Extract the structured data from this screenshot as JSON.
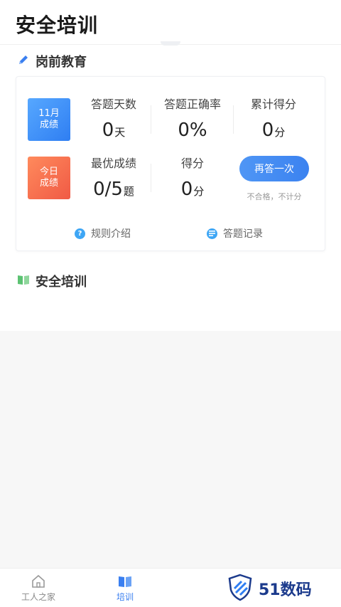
{
  "header": {
    "title": "安全培训"
  },
  "section_education": {
    "title": "岗前教育"
  },
  "badges": {
    "month": {
      "line1": "11月",
      "line2": "成绩"
    },
    "today": {
      "line1": "今日",
      "line2": "成绩"
    }
  },
  "stats": {
    "answer_days": {
      "label": "答题天数",
      "value": "0",
      "unit": "天"
    },
    "accuracy": {
      "label": "答题正确率",
      "value": "0%",
      "unit": ""
    },
    "total_score": {
      "label": "累计得分",
      "value": "0",
      "unit": "分"
    },
    "best_score": {
      "label": "最优成绩",
      "value": "0/5",
      "unit": "题"
    },
    "score": {
      "label": "得分",
      "value": "0",
      "unit": "分"
    }
  },
  "retry": {
    "label": "再答一次",
    "note": "不合格，不计分"
  },
  "links": {
    "rules": {
      "label": "规则介绍",
      "icon": "question-icon"
    },
    "records": {
      "label": "答题记录",
      "icon": "record-icon"
    }
  },
  "section_training": {
    "title": "安全培训"
  },
  "tabbar": {
    "items": [
      {
        "label": "工人之家",
        "icon": "home-icon",
        "active": false
      },
      {
        "label": "培训",
        "icon": "book-icon",
        "active": true
      }
    ]
  },
  "watermark": {
    "text": "51数码"
  },
  "colors": {
    "accent": "#3a7ff0",
    "badge_month": "#3d8cf5",
    "badge_today": "#f26a4e",
    "section_green": "#5cc272"
  }
}
